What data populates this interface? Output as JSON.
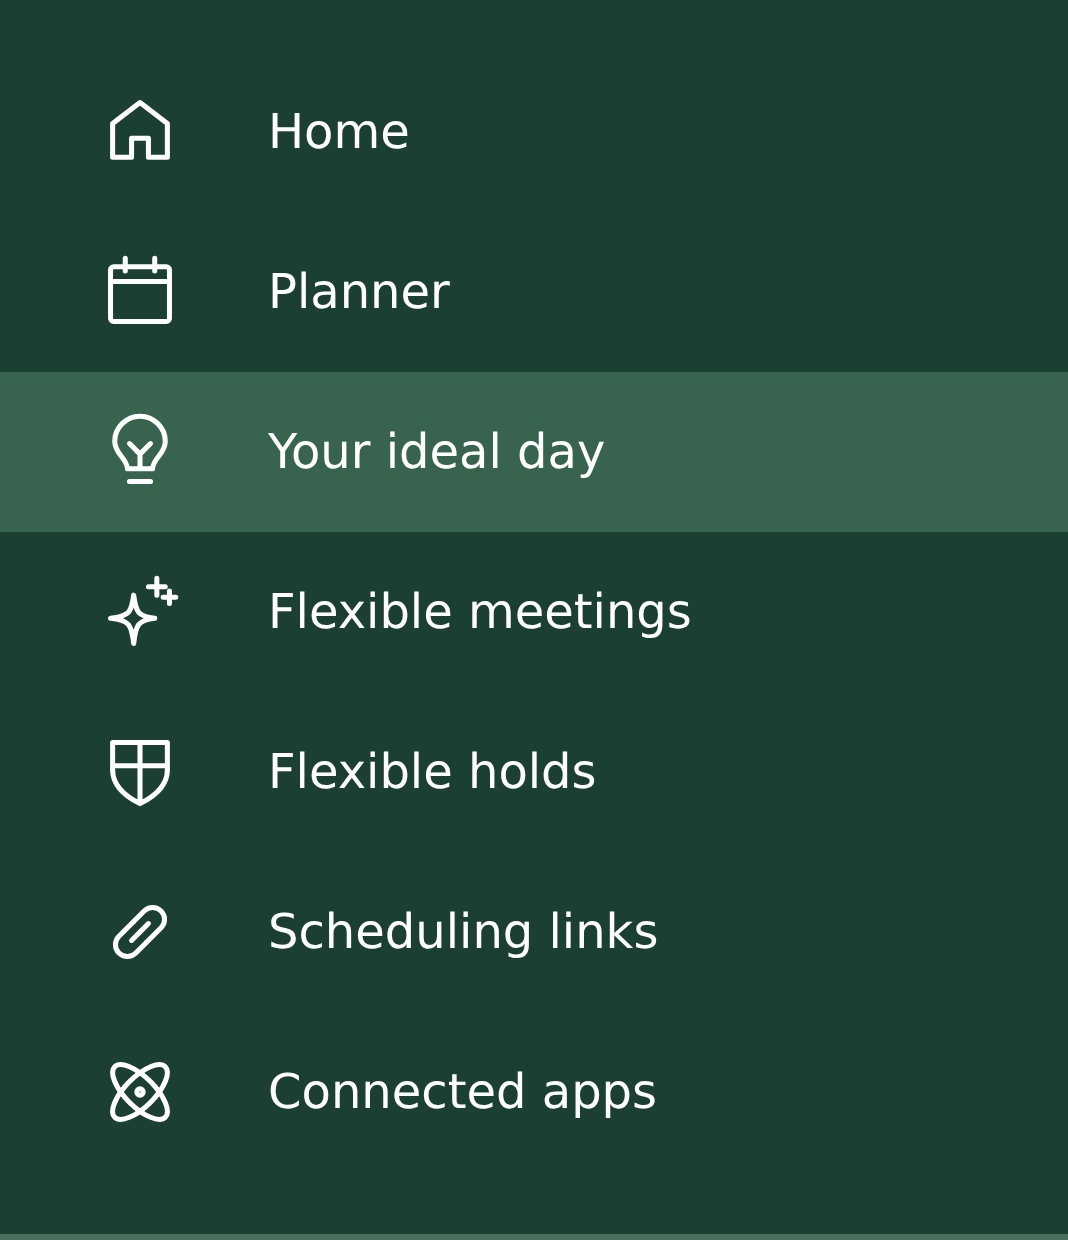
{
  "nav": [
    {
      "label": "Home",
      "kind": "home",
      "selected": false
    },
    {
      "label": "Planner",
      "kind": "calendar",
      "selected": false
    },
    {
      "label": "Your ideal day",
      "kind": "bulb",
      "selected": true
    },
    {
      "label": "Flexible meetings",
      "kind": "sparkle",
      "selected": false
    },
    {
      "label": "Flexible holds",
      "kind": "shield",
      "selected": false
    },
    {
      "label": "Scheduling links",
      "kind": "link",
      "selected": false
    },
    {
      "label": "Connected apps",
      "kind": "atom",
      "selected": false
    }
  ]
}
